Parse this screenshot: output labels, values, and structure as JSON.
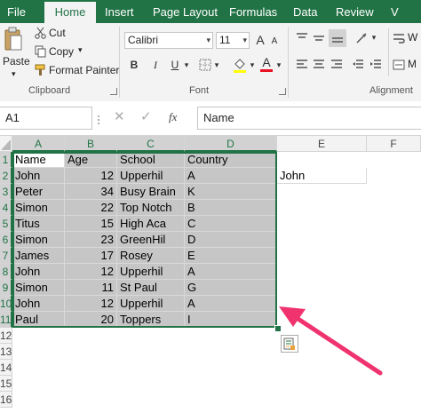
{
  "ribbon_tabs": [
    "File",
    "Home",
    "Insert",
    "Page Layout",
    "Formulas",
    "Data",
    "Review",
    "V"
  ],
  "active_tab": "Home",
  "clipboard": {
    "paste": "Paste",
    "cut": "Cut",
    "copy": "Copy",
    "format_painter": "Format Painter",
    "group_label": "Clipboard"
  },
  "font": {
    "name": "Calibri",
    "size": "11",
    "group_label": "Font",
    "bold": "B",
    "italic": "I",
    "underline": "U",
    "grow": "A",
    "shrink": "A",
    "font_color": "A"
  },
  "alignment": {
    "group_label": "Alignment",
    "wrap": "W",
    "merge": "M"
  },
  "formula_bar": {
    "name_box": "A1",
    "fx": "fx",
    "content": "Name"
  },
  "columns": [
    "A",
    "B",
    "C",
    "D",
    "E",
    "F"
  ],
  "rows": [
    "1",
    "2",
    "3",
    "4",
    "5",
    "6",
    "7",
    "8",
    "9",
    "10",
    "11",
    "12",
    "13",
    "14",
    "15",
    "16"
  ],
  "table": [
    [
      "Name",
      "Age",
      "School",
      "Country"
    ],
    [
      "John",
      "12",
      "Upperhil",
      "A"
    ],
    [
      "Peter",
      "34",
      "Busy Brain",
      "K"
    ],
    [
      "Simon",
      "22",
      "Top Notch",
      "B"
    ],
    [
      "Titus",
      "15",
      "High Aca",
      "C"
    ],
    [
      "Simon",
      "23",
      "GreenHil",
      "D"
    ],
    [
      "James",
      "17",
      "Rosey",
      "E"
    ],
    [
      "John",
      "12",
      "Upperhil",
      "A"
    ],
    [
      "Simon",
      "11",
      "St Paul",
      "G"
    ],
    [
      "John",
      "12",
      "Upperhil",
      "A"
    ],
    [
      "Paul",
      "20",
      "Toppers",
      "I"
    ]
  ],
  "e2_value": "John",
  "colors": {
    "excel_green": "#217346",
    "selection_fill": "#c6c6c6",
    "arrow": "#f0336f"
  }
}
